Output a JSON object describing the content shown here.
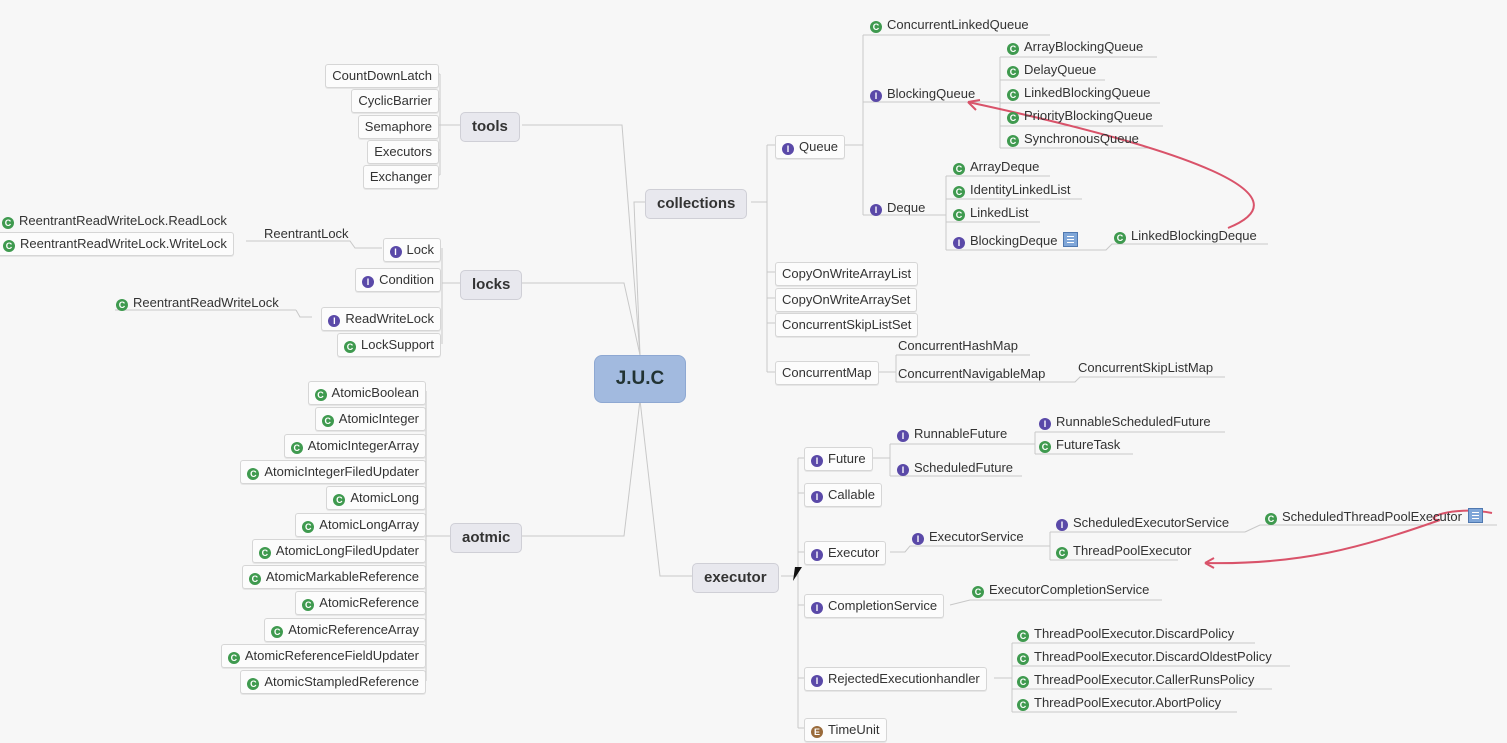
{
  "root": {
    "label": "J.U.C"
  },
  "branches": {
    "tools": {
      "label": "tools",
      "items": [
        "CountDownLatch",
        "CyclicBarrier",
        "Semaphore",
        "Executors",
        "Exchanger"
      ]
    },
    "locks": {
      "label": "locks",
      "lock": {
        "label": "Lock",
        "icon": "interface",
        "impl": "ReentrantLock",
        "impl_children": [
          "ReentrantReadWriteLock.ReadLock",
          "ReentrantReadWriteLock.WriteLock"
        ]
      },
      "condition": {
        "label": "Condition",
        "icon": "interface"
      },
      "readwritelock": {
        "label": "ReadWriteLock",
        "icon": "interface",
        "impl": "ReentrantReadWriteLock"
      },
      "locksupport": {
        "label": "LockSupport",
        "icon": "class"
      }
    },
    "aotmic": {
      "label": "aotmic",
      "items": [
        "AtomicBoolean",
        "AtomicInteger",
        "AtomicIntegerArray",
        "AtomicIntegerFiledUpdater",
        "AtomicLong",
        "AtomicLongArray",
        "AtomicLongFiledUpdater",
        "AtomicMarkableReference",
        "AtomicReference",
        "AtomicReferenceArray",
        "AtomicReferenceFieldUpdater",
        "AtomicStampledReference"
      ]
    },
    "collections": {
      "label": "collections",
      "queue": {
        "label": "Queue",
        "concurrent_linked_queue": "ConcurrentLinkedQueue",
        "blocking_queue": {
          "label": "BlockingQueue",
          "items": [
            "ArrayBlockingQueue",
            "DelayQueue",
            "LinkedBlockingQueue",
            "PriorityBlockingQueue",
            "SynchronousQueue"
          ]
        },
        "deque": {
          "label": "Deque",
          "items": [
            "ArrayDeque",
            "IdentityLinkedList",
            "LinkedList"
          ],
          "blocking_deque": "BlockingDeque",
          "blocking_deque_impl": "LinkedBlockingDeque"
        }
      },
      "lists": [
        "CopyOnWriteArrayList",
        "CopyOnWriteArraySet",
        "ConcurrentSkipListSet"
      ],
      "map": {
        "label": "ConcurrentMap",
        "children": [
          "ConcurrentHashMap",
          "ConcurrentNavigableMap"
        ],
        "navigable_impl": "ConcurrentSkipListMap"
      }
    },
    "executor": {
      "label": "executor",
      "future": {
        "label": "Future",
        "runnable_future": "RunnableFuture",
        "scheduled_future": "ScheduledFuture",
        "rf_children": [
          "RunnableScheduledFuture",
          "FutureTask"
        ]
      },
      "callable": "Callable",
      "executor": {
        "label": "Executor",
        "service": "ExecutorService",
        "scheduled_service": "ScheduledExecutorService",
        "scheduled_impl": "ScheduledThreadPoolExecutor",
        "tpe": "ThreadPoolExecutor"
      },
      "completion": {
        "label": "CompletionService",
        "impl": "ExecutorCompletionService"
      },
      "rejected": {
        "label": "RejectedExecutionhandler",
        "items": [
          "ThreadPoolExecutor.DiscardPolicy",
          "ThreadPoolExecutor.DiscardOldestPolicy",
          "ThreadPoolExecutor.CallerRunsPolicy",
          "ThreadPoolExecutor.AbortPolicy"
        ]
      },
      "timeunit": "TimeUnit"
    }
  },
  "icons": {
    "class": "C",
    "interface": "I",
    "enum": "E"
  },
  "colors": {
    "arrow": "#d9536a",
    "root": "#a2badf",
    "class_icon": "#3f9a4f",
    "interface_icon": "#5a49a8",
    "enum_icon": "#9a6b3b"
  }
}
